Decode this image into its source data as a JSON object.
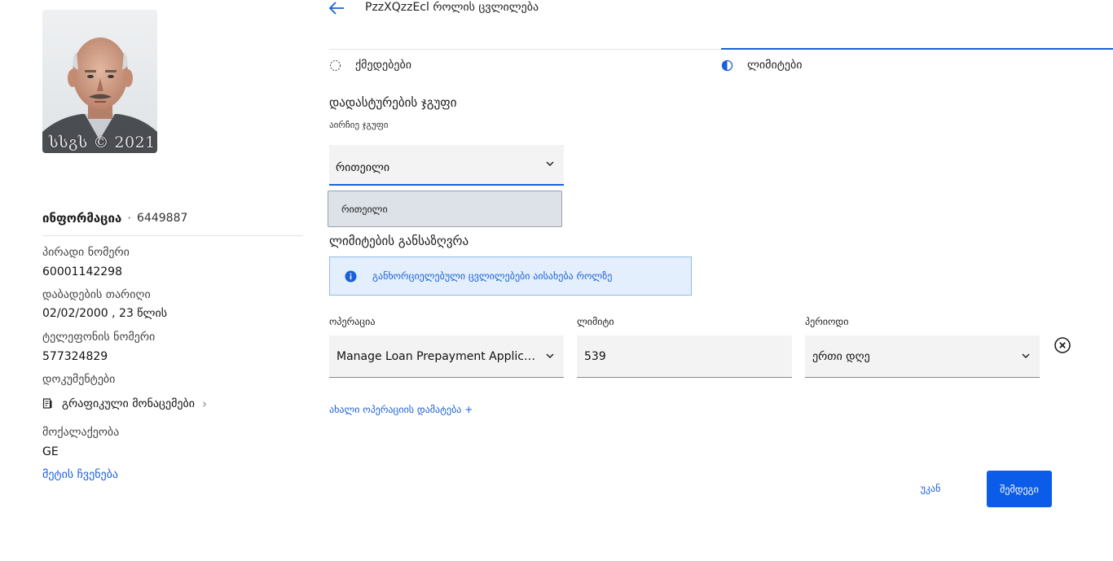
{
  "colors": {
    "accent": "#1b5fd9",
    "primary_button": "#0b5ce8",
    "notice_bg": "#e3effc",
    "input_bg": "#f3f3f3"
  },
  "profile": {
    "photo_watermark": "სსგს © 2021",
    "info_title": "ინფორმაცია",
    "info_separator": "·",
    "info_id": "6449887",
    "fields": [
      {
        "label": "პირადი ნომერი",
        "value": "60001142298"
      },
      {
        "label": "დაბადების თარიღი",
        "value": "02/02/2000 , 23 წლის"
      },
      {
        "label": "ტელეფონის ნომერი",
        "value": "577324829"
      },
      {
        "label": "დოკუმენტები"
      },
      {
        "label": "მოქალაქეობა",
        "value": "GE"
      }
    ],
    "documents_link": {
      "icon": "document-icon",
      "label": "გრაფიკული მონაცემები"
    },
    "show_more": "მეტის ჩვენება"
  },
  "header": {
    "back_icon": "arrow-left-icon",
    "title": "PzzXQzzEcl როლის ცვლილება"
  },
  "steps": [
    {
      "label": "ქმედებები",
      "icon": "dashed-circle-icon",
      "active": false
    },
    {
      "label": "ლიმიტები",
      "icon": "half-circle-icon",
      "active": true
    }
  ],
  "approval_group": {
    "title": "დადასტურების ჯგუფი",
    "sublabel": "აირჩიე ჯგუფი",
    "selected": "რითეილი",
    "dropdown_options": [
      "რითეილი"
    ]
  },
  "limits": {
    "title": "ლიმიტების განსაზღვრა",
    "notice_icon": "info-icon",
    "notice": "განხორციელებული ცვლილებები აისახება როლზე",
    "columns": {
      "operation": "ოპერაცია",
      "limit": "ლიმიტი",
      "period": "პერიოდი"
    },
    "row": {
      "operation": "Manage Loan Prepayment Applicati...",
      "limit": "539",
      "period": "ერთი დღე"
    },
    "add_operation": "ახალი ოპერაციის დამატება +"
  },
  "footer": {
    "back_label": "უკან",
    "save_label": "შემდეგი"
  }
}
